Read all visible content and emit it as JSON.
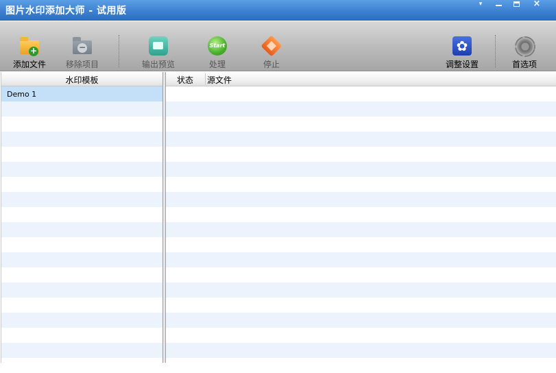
{
  "window": {
    "title": "图片水印添加大师 - 试用版",
    "menu_glyph": "▾",
    "close_glyph": "×"
  },
  "toolbar": {
    "add_file": "添加文件",
    "remove_item": "移除项目",
    "output_preview": "输出预览",
    "process": "处理",
    "start_icon_text": "Start",
    "stop": "停止",
    "adjust_settings": "调整设置",
    "gear_glyph": "✿",
    "preferences": "首选项"
  },
  "left_panel": {
    "header": "水印模板",
    "items": [
      "Demo 1"
    ]
  },
  "right_panel": {
    "columns": [
      "状态",
      "源文件"
    ]
  }
}
